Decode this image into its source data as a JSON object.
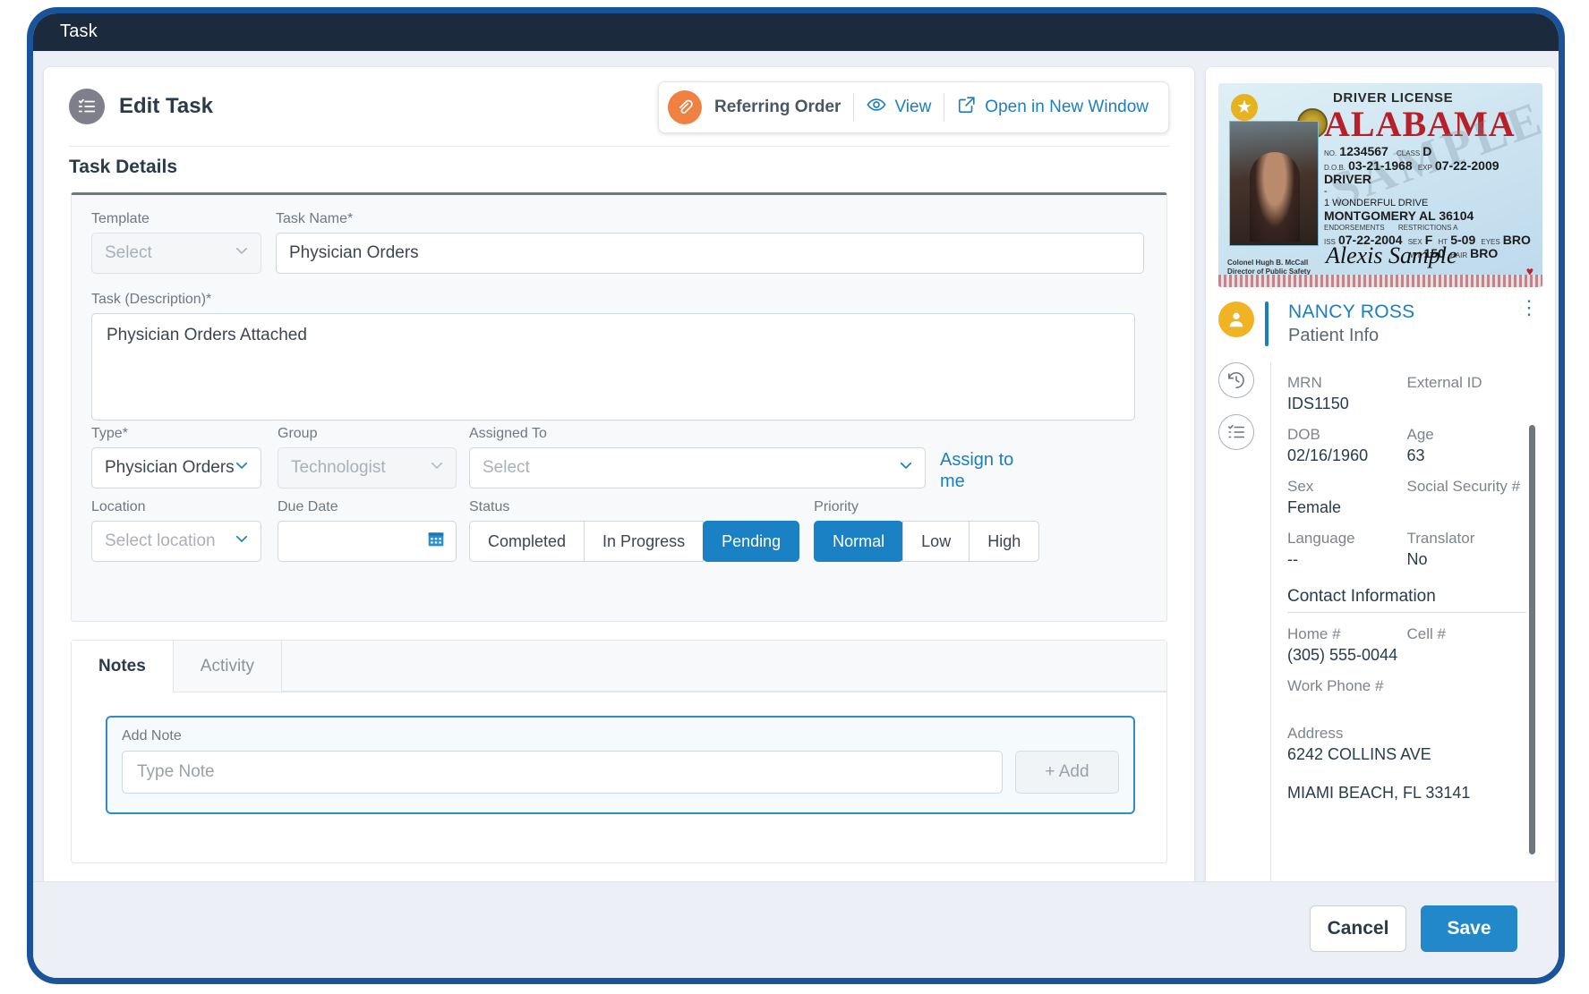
{
  "window": {
    "title": "Task"
  },
  "header": {
    "title": "Edit Task",
    "icon": "task-list-icon",
    "referring_order": {
      "label": "Referring Order",
      "attachment_icon": "paperclip-icon",
      "view_label": "View",
      "view_icon": "eye-icon",
      "open_new_window_label": "Open in New Window",
      "open_new_window_icon": "external-link-icon"
    }
  },
  "section": {
    "task_details_title": "Task Details"
  },
  "form": {
    "template": {
      "label": "Template",
      "value": "",
      "placeholder": "Select"
    },
    "task_name": {
      "label": "Task Name*",
      "value": "Physician Orders"
    },
    "description": {
      "label": "Task (Description)*",
      "value": "Physician Orders Attached"
    },
    "type": {
      "label": "Type*",
      "value": "Physician Orders"
    },
    "group": {
      "label": "Group",
      "value": "Technologist"
    },
    "assigned_to": {
      "label": "Assigned To",
      "value": "",
      "placeholder": "Select"
    },
    "assign_to_me": "Assign to me",
    "location": {
      "label": "Location",
      "value": "",
      "placeholder": "Select location"
    },
    "due_date": {
      "label": "Due Date",
      "value": "",
      "icon": "calendar-icon"
    },
    "status": {
      "label": "Status",
      "options": [
        "Completed",
        "In Progress",
        "Pending"
      ],
      "selected": "Pending"
    },
    "priority": {
      "label": "Priority",
      "options": [
        "Normal",
        "Low",
        "High"
      ],
      "selected": "Normal"
    }
  },
  "notes": {
    "tabs": [
      {
        "label": "Notes",
        "active": true
      },
      {
        "label": "Activity",
        "active": false
      }
    ],
    "add_note_label": "Add Note",
    "note_placeholder": "Type Note",
    "add_button": "+ Add"
  },
  "patient": {
    "name": "NANCY ROSS",
    "subtitle": "Patient Info",
    "avatar_icon": "person-icon",
    "menu_icon": "kebab-menu-icon",
    "side_icons": [
      "history-clock-icon",
      "task-list-icon"
    ],
    "fields": [
      {
        "k1": "MRN",
        "v1": "IDS1150",
        "k2": "External ID",
        "v2": ""
      },
      {
        "k1": "DOB",
        "v1": "02/16/1960",
        "k2": "Age",
        "v2": "63"
      },
      {
        "k1": "Sex",
        "v1": "Female",
        "k2": "Social Security #",
        "v2": ""
      },
      {
        "k1": "Language",
        "v1": "--",
        "k2": "Translator",
        "v2": "No"
      }
    ],
    "contact_title": "Contact Information",
    "contact": [
      {
        "k1": "Home #",
        "v1": "(305) 555-0044",
        "k2": "Cell #",
        "v2": ""
      },
      {
        "k1": "Work Phone #",
        "v1": "",
        "k2": "",
        "v2": ""
      }
    ],
    "address_label": "Address",
    "address_line1": "6242 COLLINS AVE",
    "address_line2": "MIAMI BEACH, FL 33141"
  },
  "license": {
    "header": "DRIVER LICENSE",
    "state": "ALABAMA",
    "watermark": "SAMPLE",
    "no_label": "NO.",
    "no_value": "1234567",
    "class_label": "CLASS",
    "class_value": "D",
    "dob_label": "D.O.B.",
    "dob_value": "03-21-1968",
    "exp_label": "EXP",
    "exp_value": "07-22-2009",
    "name_line": "DRIVER",
    "dash": "-",
    "address1": "1 WONDERFUL DRIVE",
    "address2": "MONTGOMERY AL 36104",
    "endorsements_label": "ENDORSEMENTS",
    "restrictions_label": "RESTRICTIONS A",
    "issued_label": "ISS",
    "issued_value": "07-22-2004",
    "sex_label": "SEX",
    "sex_value": "F",
    "ht_label": "HT",
    "ht_value": "5-09",
    "eyes_label": "EYES",
    "eyes_value": "BRO",
    "wt_label": "WT",
    "wt_value": "150",
    "hair_label": "HAIR",
    "hair_value": "BRO",
    "signature": "Alexis Sample",
    "footer1": "Colonel Hugh B. McCall",
    "footer2": "Director of Public Safety"
  },
  "footer": {
    "cancel": "Cancel",
    "save": "Save"
  },
  "colors": {
    "accent_blue": "#1a7fc1",
    "primary_button": "#2288c9",
    "selected_segment": "#1a82c4",
    "attachment_orange": "#ef8242",
    "avatar_yellow": "#f0b323",
    "titlebar": "#1b2a3c",
    "frame_border": "#19549b"
  }
}
